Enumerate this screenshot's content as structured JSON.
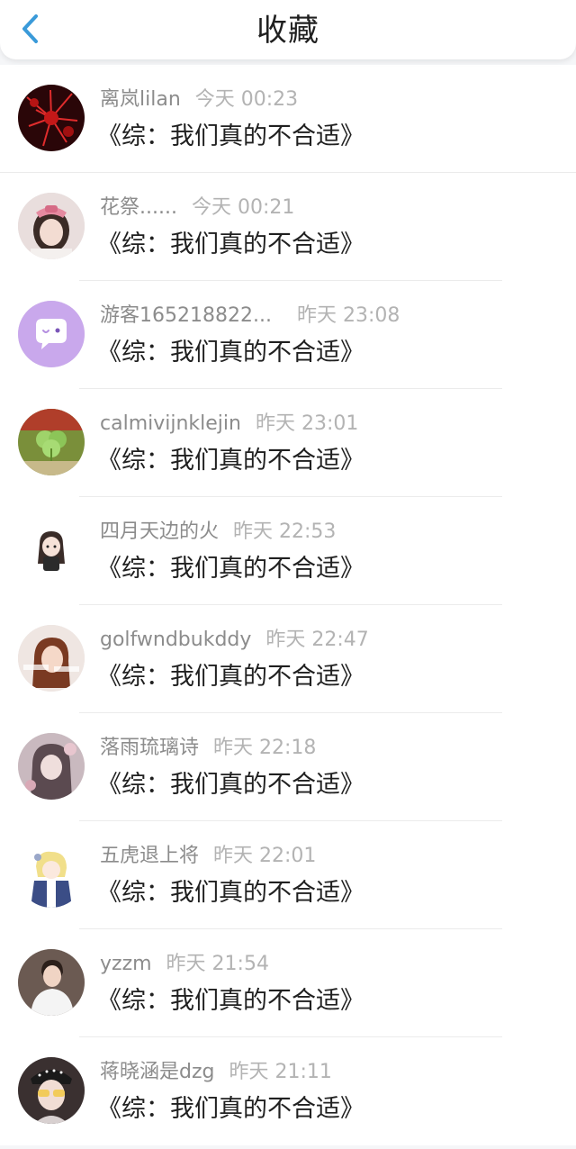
{
  "header": {
    "title": "收藏",
    "back_icon": "chevron-left-icon",
    "accent_color": "#3a9ad9"
  },
  "items": [
    {
      "name": "离岚lilan",
      "time": "今天 00:23",
      "content": "《综：我们真的不合适》",
      "avatar": "red-flower-avatar"
    },
    {
      "name": "花祭......",
      "time": "今天 00:21",
      "content": "《综：我们真的不合适》",
      "avatar": "girl-pink-bow-avatar"
    },
    {
      "name": "游客165218822...",
      "time": "昨天 23:08",
      "content": "《综：我们真的不合适》",
      "avatar": "purple-chat-bubble-avatar"
    },
    {
      "name": "calmivijnklejin",
      "time": "昨天 23:01",
      "content": "《综：我们真的不合适》",
      "avatar": "clover-avatar"
    },
    {
      "name": "四月天边的火",
      "time": "昨天 22:53",
      "content": "《综：我们真的不合适》",
      "avatar": "chibi-girl-avatar"
    },
    {
      "name": "golfwndbukddy",
      "time": "昨天 22:47",
      "content": "《综：我们真的不合适》",
      "avatar": "woman-portrait-avatar"
    },
    {
      "name": "落雨琉璃诗",
      "time": "昨天 22:18",
      "content": "《综：我们真的不合适》",
      "avatar": "illustrated-girl-avatar"
    },
    {
      "name": "五虎退上将",
      "time": "昨天 22:01",
      "content": "《综：我们真的不合适》",
      "avatar": "anime-boy-avatar"
    },
    {
      "name": "yzzm",
      "time": "昨天 21:54",
      "content": "《综：我们真的不合适》",
      "avatar": "man-white-shirt-avatar"
    },
    {
      "name": "蒋晓涵是dzg",
      "time": "昨天 21:11",
      "content": "《综：我们真的不合适》",
      "avatar": "anime-glasses-avatar"
    }
  ]
}
